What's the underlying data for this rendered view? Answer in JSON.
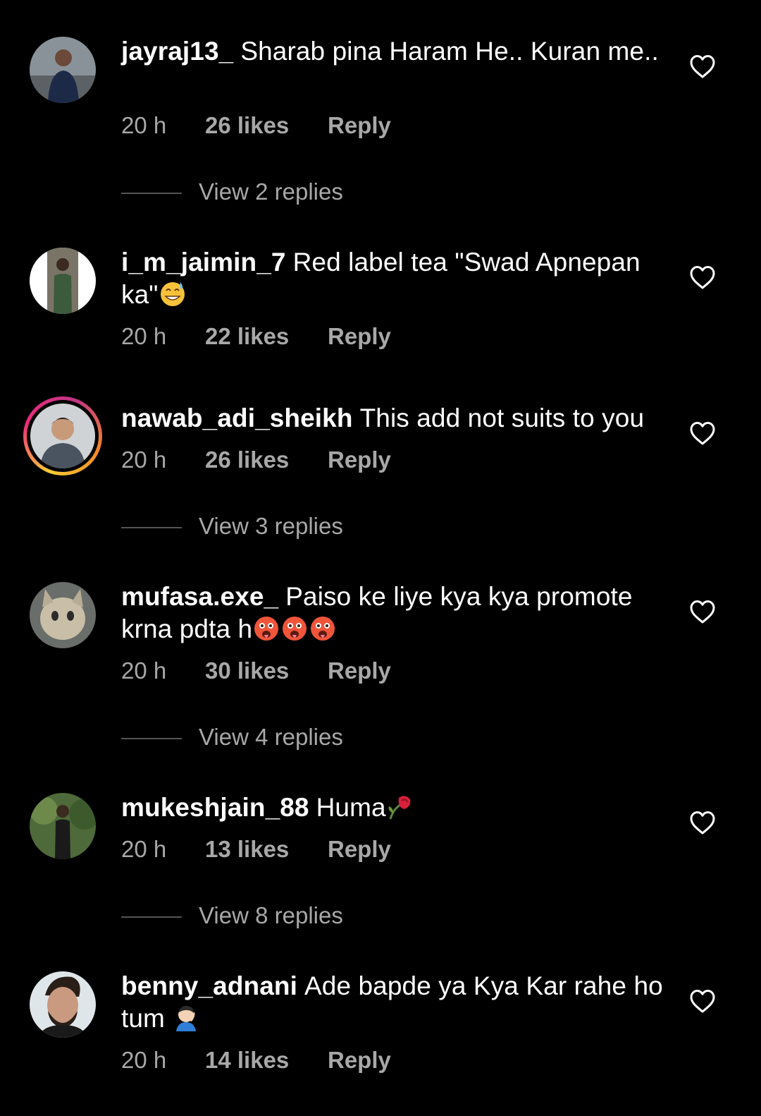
{
  "comments": [
    {
      "username": "jayraj13_",
      "text": "Sharab pina Haram He.. Kuran me..",
      "emoji": "",
      "time": "20 h",
      "likes": "26 likes",
      "reply": "Reply",
      "view_replies": "View 2 replies"
    },
    {
      "username": "i_m_jaimin_7",
      "text": "Red label tea \"Swad Apnepan ka\"",
      "emoji": "grinning-sweat-emoji",
      "time": "20 h",
      "likes": "22 likes",
      "reply": "Reply",
      "view_replies": ""
    },
    {
      "username": "nawab_adi_sheikh",
      "text": "This add not suits to you",
      "emoji": "",
      "time": "20 h",
      "likes": "26 likes",
      "reply": "Reply",
      "view_replies": "View 3 replies"
    },
    {
      "username": "mufasa.exe_",
      "text": "Paiso ke liye kya kya promote krna pdta h",
      "emoji": "hot-face-emoji x3",
      "time": "20 h",
      "likes": "30 likes",
      "reply": "Reply",
      "view_replies": "View 4 replies"
    },
    {
      "username": "mukeshjain_88",
      "text": "Huma",
      "emoji": "wilted-flower-emoji",
      "time": "20 h",
      "likes": "13 likes",
      "reply": "Reply",
      "view_replies": "View 8 replies"
    },
    {
      "username": "benny_adnani",
      "text": "Ade bapde ya Kya Kar rahe ho tum",
      "emoji": "person-facepalming-emoji",
      "time": "20 h",
      "likes": "14 likes",
      "reply": "Reply",
      "view_replies": ""
    }
  ],
  "colors": {
    "background": "#000000",
    "text": "#ffffff",
    "secondary": "#a8a8a8",
    "divider": "#545454"
  },
  "icons": {
    "like": "heart-outline-icon"
  }
}
